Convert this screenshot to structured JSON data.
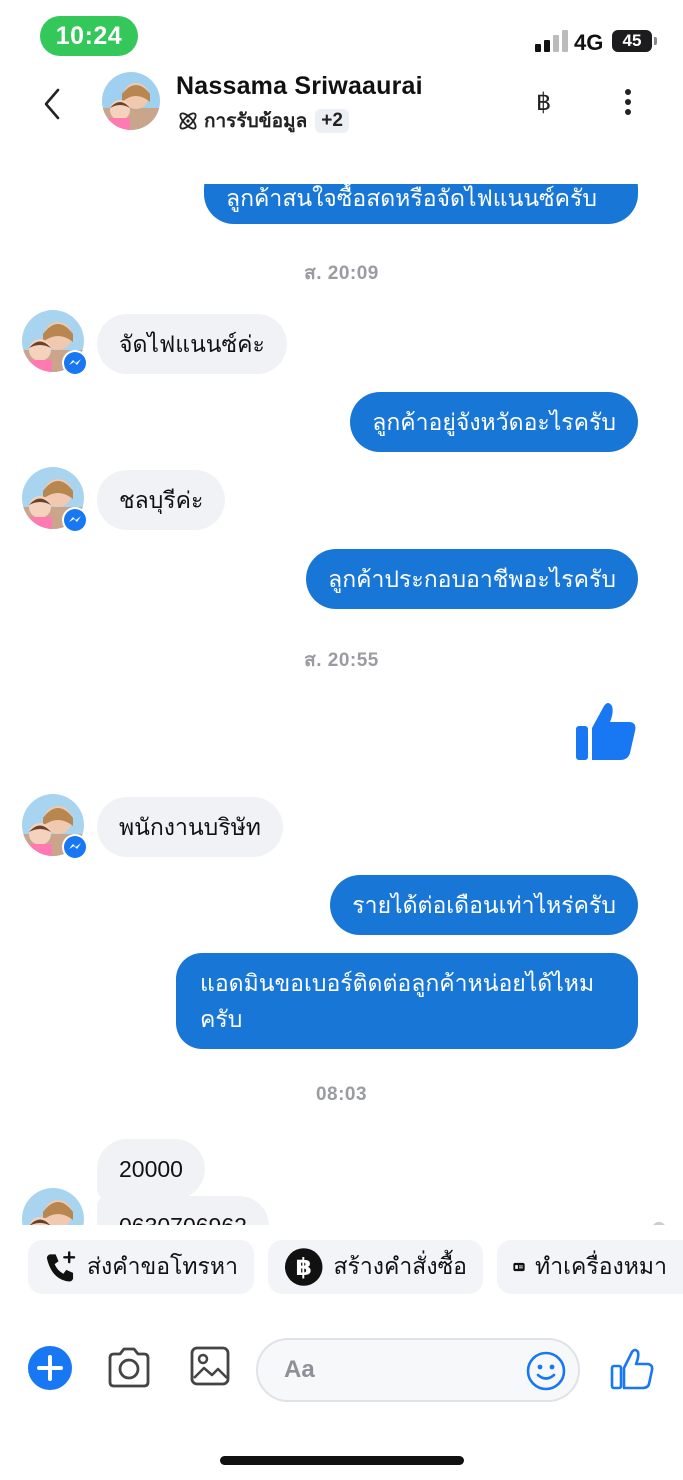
{
  "status_bar": {
    "time": "10:24",
    "network": "4G",
    "battery": "45"
  },
  "header": {
    "contact_name": "Nassama Sriwaaurai",
    "label": "การรับข้อมูล",
    "extra_labels": "+2",
    "payment_icon": "baht-icon",
    "menu_icon": "more-vertical-icon"
  },
  "messages": {
    "clipped_top": "ลูกค้าสนใจซื้อสดหรือจัดไฟแนนซ์ครับ",
    "ts1": "ส. 20:09",
    "in1": "จัดไฟแนนซ์ค่ะ",
    "out1": "ลูกค้าอยู่จังหวัดอะไรครับ",
    "in2": "ชลบุรีค่ะ",
    "out2": "ลูกค้าประกอบอาชีพอะไรครับ",
    "ts2": "ส. 20:55",
    "in3": "พนักงานบริษัท",
    "out3": "รายได้ต่อเดือนเท่าไหร่ครับ",
    "out4": "แอดมินขอเบอร์ติดต่อลูกค้าหน่อยได้ไหมครับ",
    "ts3": "08:03",
    "in4": "20000",
    "in5": "0630706962"
  },
  "quick_actions": {
    "call": "ส่งคำขอโทรหา",
    "order": "สร้างคำสั่งซื้อ",
    "label": "ทำเครื่องหมา"
  },
  "composer": {
    "placeholder": "Aa"
  },
  "colors": {
    "outgoing": "#1877d6",
    "incoming": "#f1f2f5",
    "accent": "#1877f2",
    "status_green": "#34c759"
  }
}
